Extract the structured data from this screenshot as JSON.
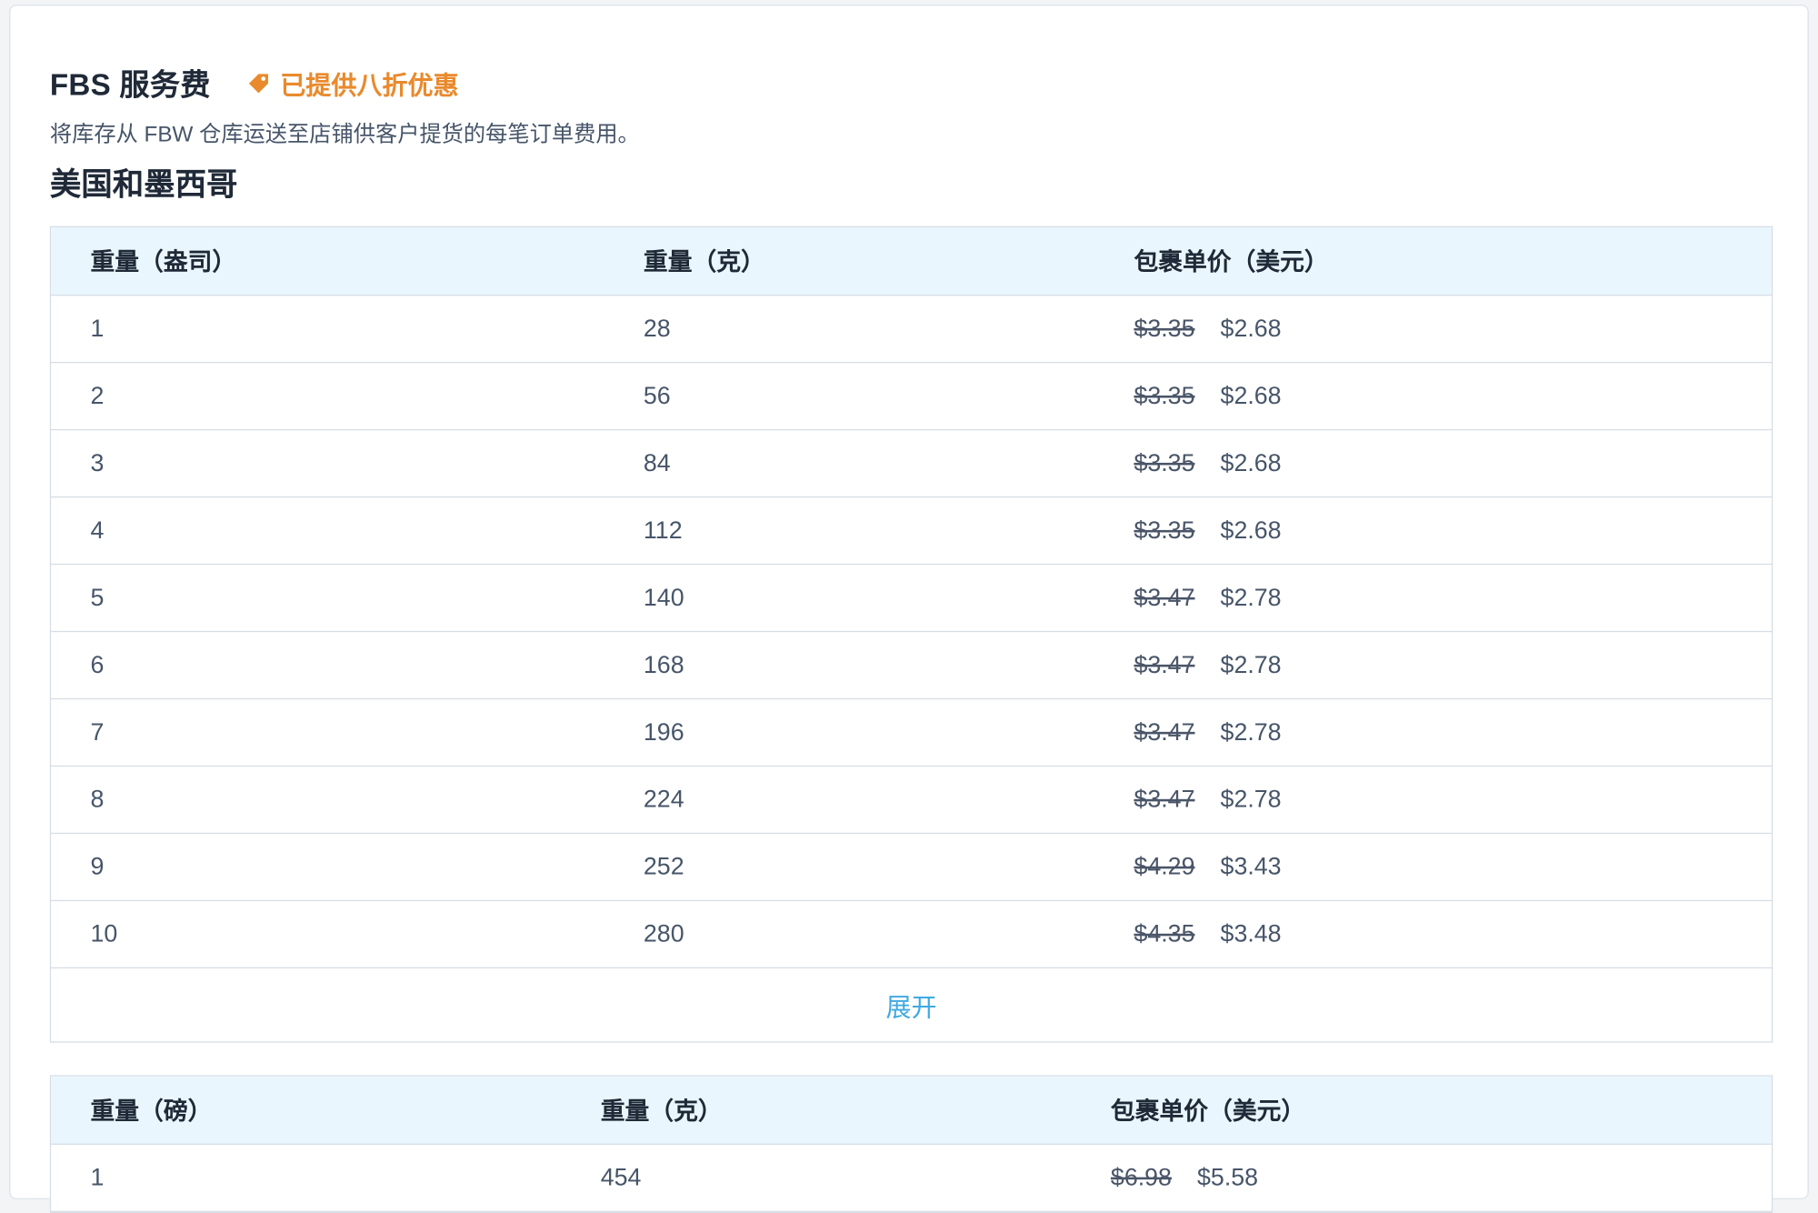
{
  "section": {
    "title": "FBS 服务费",
    "badge_label": "已提供八折优惠",
    "badge_color": "#e98a2d",
    "description": "将库存从 FBW 仓库运送至店铺供客户提货的每笔订单费用。",
    "region_title": "美国和墨西哥"
  },
  "table_ounces": {
    "headers": [
      "重量（盎司）",
      "重量（克）",
      "包裹单价（美元）"
    ],
    "rows": [
      {
        "weight": "1",
        "grams": "28",
        "old_price": "$3.35",
        "new_price": "$2.68"
      },
      {
        "weight": "2",
        "grams": "56",
        "old_price": "$3.35",
        "new_price": "$2.68"
      },
      {
        "weight": "3",
        "grams": "84",
        "old_price": "$3.35",
        "new_price": "$2.68"
      },
      {
        "weight": "4",
        "grams": "112",
        "old_price": "$3.35",
        "new_price": "$2.68"
      },
      {
        "weight": "5",
        "grams": "140",
        "old_price": "$3.47",
        "new_price": "$2.78"
      },
      {
        "weight": "6",
        "grams": "168",
        "old_price": "$3.47",
        "new_price": "$2.78"
      },
      {
        "weight": "7",
        "grams": "196",
        "old_price": "$3.47",
        "new_price": "$2.78"
      },
      {
        "weight": "8",
        "grams": "224",
        "old_price": "$3.47",
        "new_price": "$2.78"
      },
      {
        "weight": "9",
        "grams": "252",
        "old_price": "$4.29",
        "new_price": "$3.43"
      },
      {
        "weight": "10",
        "grams": "280",
        "old_price": "$4.35",
        "new_price": "$3.48"
      }
    ],
    "expand_label": "展开"
  },
  "table_pounds": {
    "headers": [
      "重量（磅）",
      "重量（克）",
      "包裹单价（美元）"
    ],
    "rows": [
      {
        "weight": "1",
        "grams": "454",
        "old_price": "$6.98",
        "new_price": "$5.58"
      }
    ]
  },
  "colors": {
    "header_bg": "#eaf6fd",
    "link": "#3fa9e0",
    "border": "#d6dde5"
  }
}
